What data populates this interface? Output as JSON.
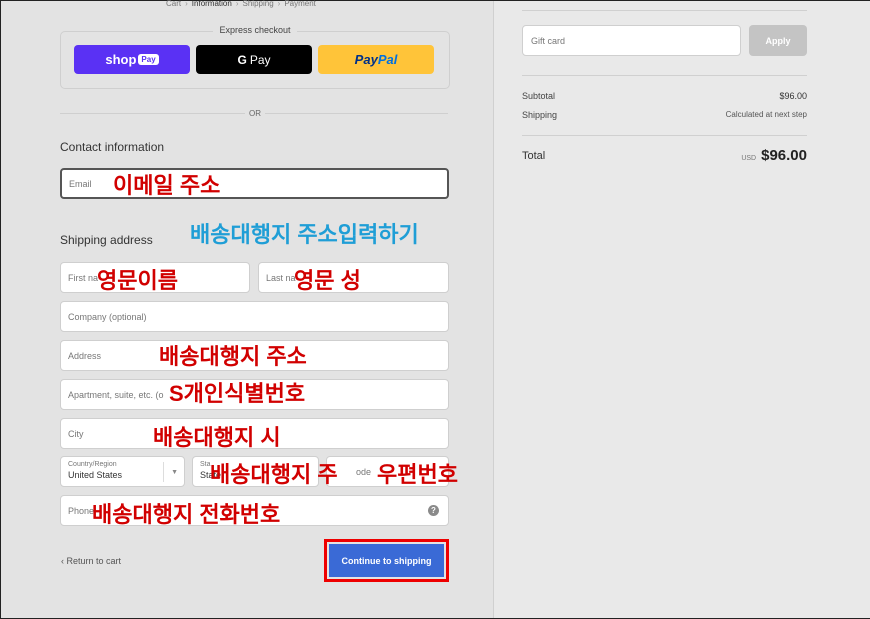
{
  "breadcrumbs": [
    "Cart",
    "Information",
    "Shipping",
    "Payment"
  ],
  "express": {
    "title": "Express checkout",
    "shop_pay": {
      "text": "shop",
      "badge": "Pay"
    },
    "google_pay": {
      "g": "G",
      "text": "Pay"
    },
    "paypal": {
      "p1": "Pay",
      "p2": "Pal"
    }
  },
  "or_text": "OR",
  "contact": {
    "heading": "Contact information",
    "email_placeholder": "Email"
  },
  "shipping": {
    "heading": "Shipping address",
    "first_name_placeholder": "First na",
    "last_name_placeholder": "Last na",
    "company_placeholder": "Company (optional)",
    "address_placeholder": "Address",
    "apartment_placeholder": "Apartment, suite, etc. (o",
    "city_placeholder": "City",
    "country_label": "Country/Region",
    "country_value": "United States",
    "state_label": "Sta",
    "state_value": "State",
    "zip_placeholder": "ode",
    "phone_placeholder": "Phone"
  },
  "overlays": {
    "email": "이메일 주소",
    "shipping_heading": "배송대행지 주소입력하기",
    "first_name": "영문이름",
    "last_name": "영문 성",
    "address": "배송대행지 주소",
    "apartment": "S개인식별번호",
    "city": "배송대행지 시",
    "state": "배송대행지 주",
    "zip": "우편번호",
    "phone": "배송대행지 전화번호"
  },
  "actions": {
    "return_label": "Return to cart",
    "continue_label": "Continue to shipping"
  },
  "summary": {
    "gift_placeholder": "Gift card",
    "apply_label": "Apply",
    "subtotal_label": "Subtotal",
    "subtotal_value": "$96.00",
    "shipping_label": "Shipping",
    "shipping_value": "Calculated at next step",
    "total_label": "Total",
    "total_currency": "USD",
    "total_value": "$96.00"
  },
  "colors": {
    "shop_pay": "#5a31f4",
    "paypal": "#ffc439",
    "continue": "#3a6ad6",
    "annotation_red": "#d10000",
    "annotation_blue": "#1f9ed6"
  }
}
